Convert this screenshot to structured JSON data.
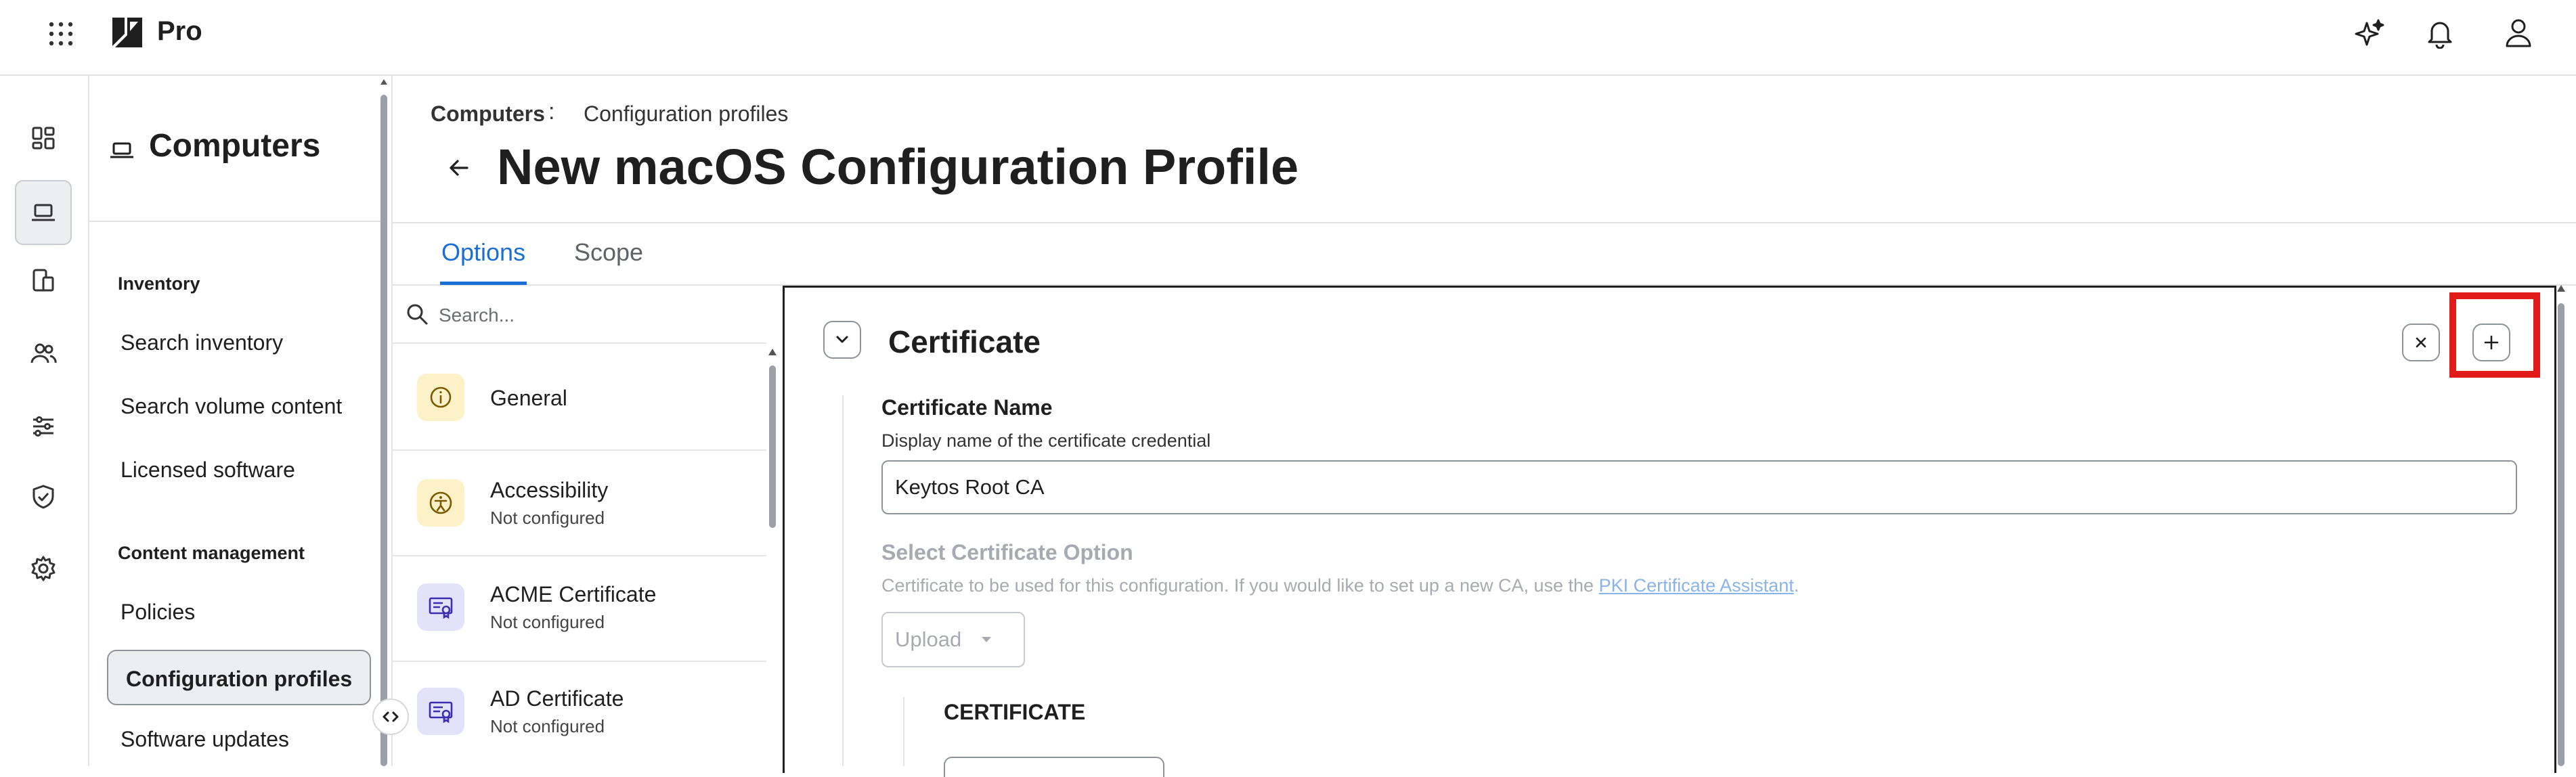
{
  "topbar": {
    "brand": "Pro",
    "icons": [
      "apps-grid-icon",
      "brand-logo-icon",
      "ai-sparkle-icon",
      "bell-icon",
      "user-icon"
    ]
  },
  "rail": {
    "items": [
      "dashboard-icon",
      "computer-icon",
      "mobile-devices-icon",
      "users-icon",
      "settings-sliders-icon",
      "shield-check-icon",
      "gear-icon"
    ],
    "active": "computer-icon"
  },
  "nav": {
    "title": "Computers",
    "groups": [
      {
        "label": "Inventory",
        "items": [
          "Search inventory",
          "Search volume content",
          "Licensed software"
        ]
      },
      {
        "label": "Content management",
        "items": [
          "Policies",
          "Configuration profiles",
          "Software updates"
        ]
      }
    ],
    "active_item": "Configuration profiles"
  },
  "breadcrumb": {
    "parent": "Computers",
    "separator": ":",
    "current": "Configuration profiles"
  },
  "page_title": "New macOS Configuration Profile",
  "tabs": [
    {
      "label": "Options",
      "active": true
    },
    {
      "label": "Scope",
      "active": false
    }
  ],
  "payload_search": {
    "placeholder": "Search..."
  },
  "payloads": [
    {
      "name": "General",
      "status": "",
      "icon": "info-icon",
      "color": "#fdf1c8"
    },
    {
      "name": "Accessibility",
      "status": "Not configured",
      "icon": "accessibility-icon",
      "color": "#fdf1c8"
    },
    {
      "name": "ACME Certificate",
      "status": "Not configured",
      "icon": "certificate-icon",
      "color": "#e3e2fb"
    },
    {
      "name": "AD Certificate",
      "status": "Not configured",
      "icon": "certificate-icon",
      "color": "#e3e2fb"
    }
  ],
  "editor": {
    "title": "Certificate",
    "cert_name_label": "Certificate Name",
    "cert_name_help": "Display name of the certificate credential",
    "cert_name_value": "Keytos Root CA",
    "option_label": "Select Certificate Option",
    "option_help_prefix": "Certificate to be used for this configuration. If you would like to set up a new CA, use the ",
    "option_help_link": "PKI Certificate Assistant",
    "option_help_suffix": ".",
    "option_value": "Upload",
    "sub_section": "CERTIFICATE"
  },
  "colors": {
    "accent": "#1a6fd6",
    "highlight": "#e11a1a"
  }
}
